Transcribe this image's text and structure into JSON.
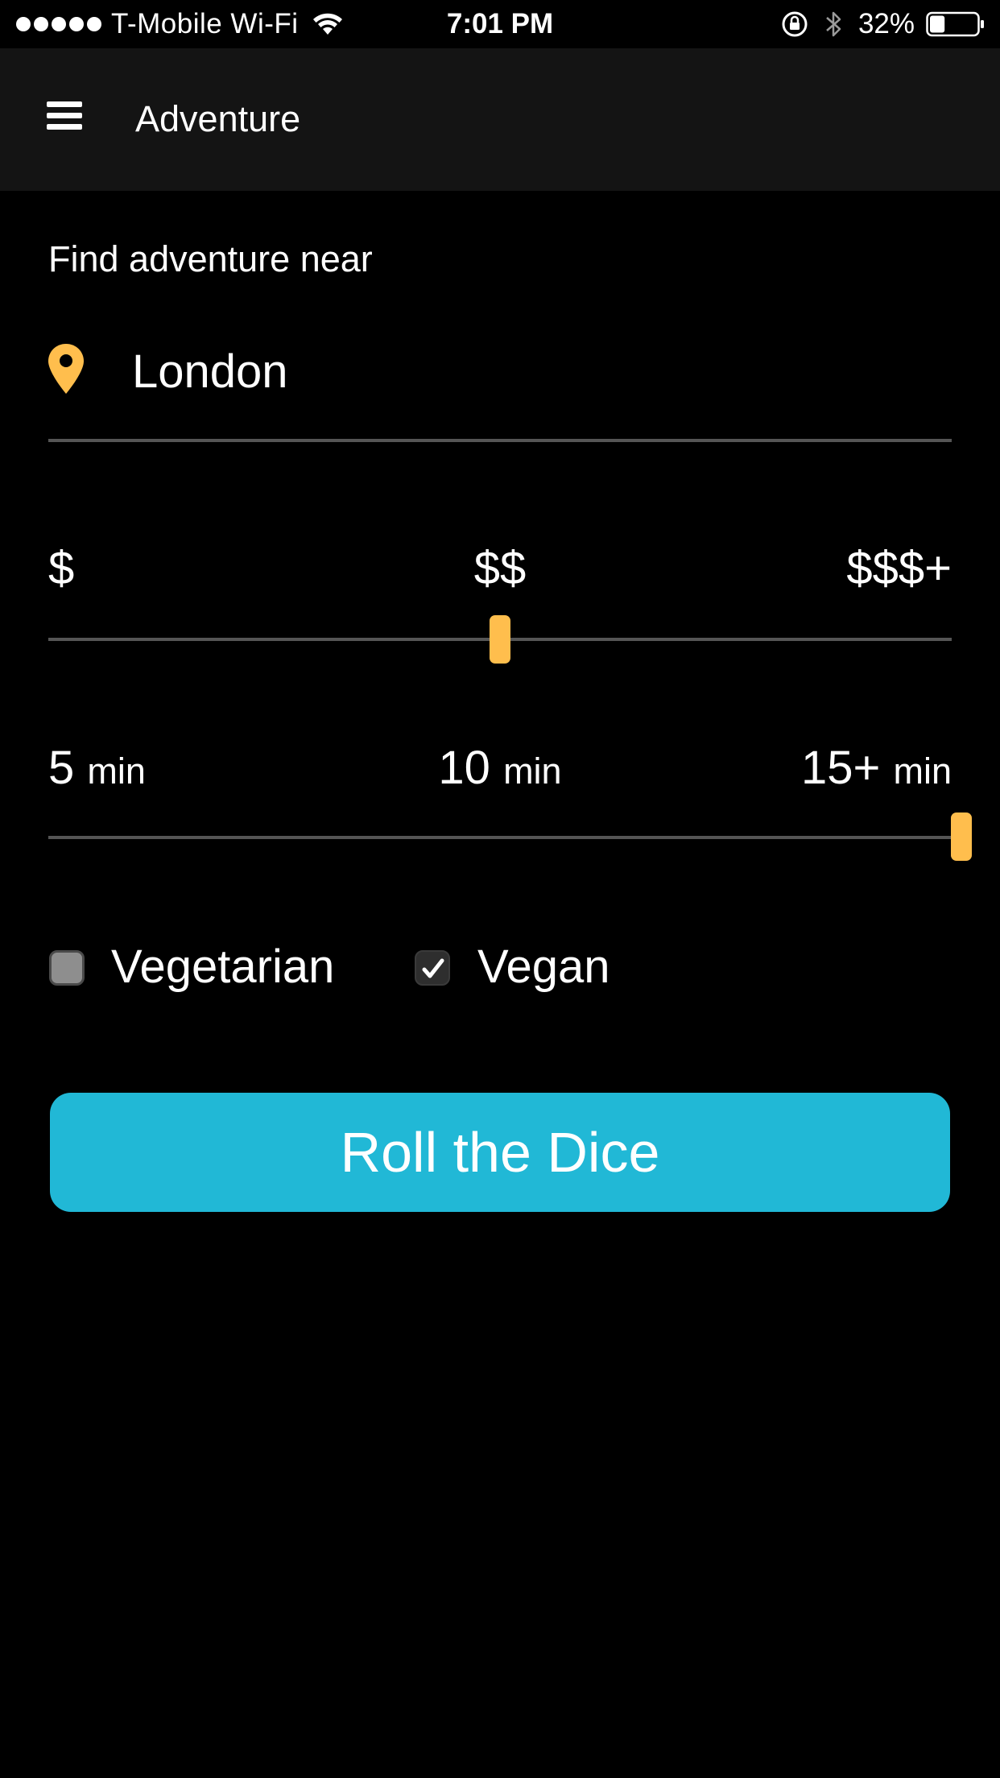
{
  "status_bar": {
    "carrier": "T-Mobile Wi-Fi",
    "time": "7:01 PM",
    "battery_percent": "32%",
    "battery_level": 0.32,
    "icons": [
      "signal-dots-icon",
      "wifi-icon",
      "orientation-lock-icon",
      "bluetooth-icon",
      "battery-icon"
    ]
  },
  "header": {
    "menu_icon": "hamburger-menu-icon",
    "title": "Adventure"
  },
  "location": {
    "label": "Find adventure near",
    "pin_icon": "map-pin-icon",
    "value": "London"
  },
  "price_slider": {
    "labels": [
      "$",
      "$$",
      "$$$+"
    ],
    "selected_index": 1,
    "selected_label": "$$"
  },
  "time_slider": {
    "labels": [
      {
        "value": "5",
        "unit": "min"
      },
      {
        "value": "10",
        "unit": "min"
      },
      {
        "value": "15+",
        "unit": "min"
      }
    ],
    "selected_index": 2,
    "selected_label": "15+ min"
  },
  "dietary": {
    "vegetarian": {
      "label": "Vegetarian",
      "checked": false
    },
    "vegan": {
      "label": "Vegan",
      "checked": true
    }
  },
  "actions": {
    "roll_button_label": "Roll the Dice"
  },
  "colors": {
    "background": "#000000",
    "header_background": "#141414",
    "accent_yellow": "#ffbe4d",
    "button_blue": "#21b8d6",
    "track_gray": "#555555",
    "text": "#ffffff"
  }
}
